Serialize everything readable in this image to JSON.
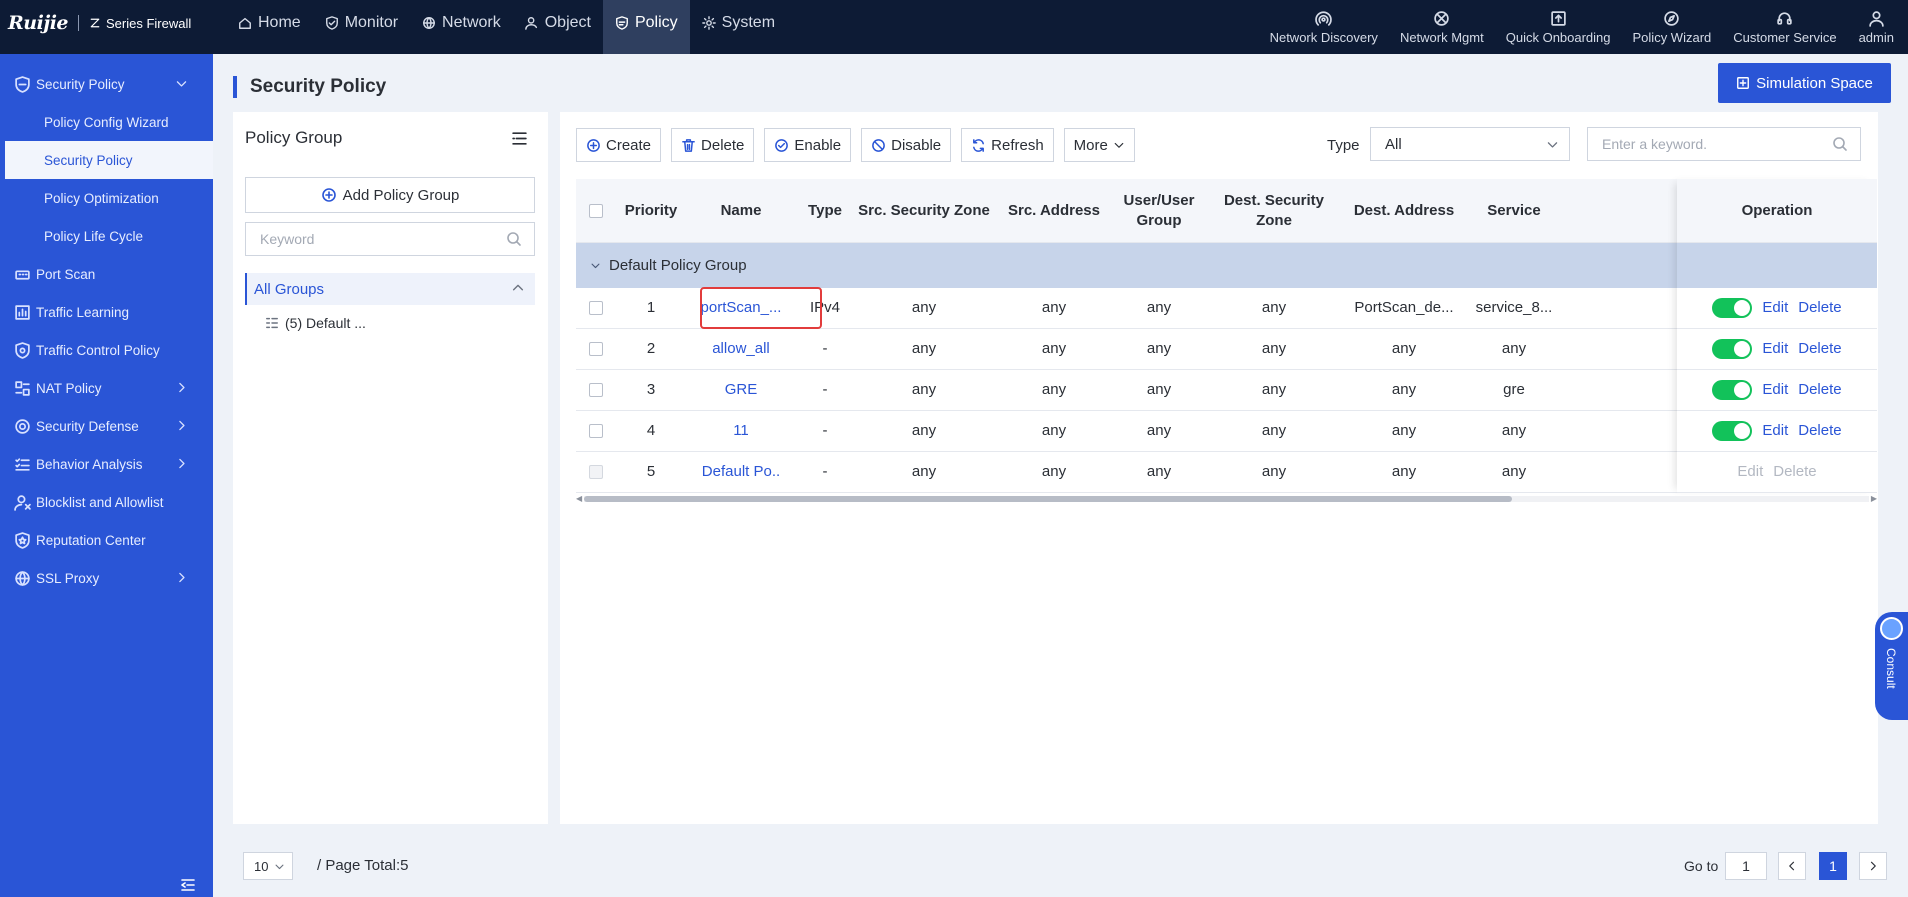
{
  "brand": {
    "logo": "Ruijie",
    "product": "Series Firewall"
  },
  "topnav": [
    {
      "label": "Home",
      "icon": "home-icon"
    },
    {
      "label": "Monitor",
      "icon": "shield-icon"
    },
    {
      "label": "Network",
      "icon": "globe-icon"
    },
    {
      "label": "Object",
      "icon": "user-icon"
    },
    {
      "label": "Policy",
      "icon": "policy-icon",
      "active": true
    },
    {
      "label": "System",
      "icon": "gear-icon"
    }
  ],
  "top_right": {
    "network_discovery": "Network Discovery",
    "network_mgmt": "Network Mgmt",
    "quick_onboarding": "Quick Onboarding",
    "policy_wizard": "Policy Wizard",
    "customer_service": "Customer Service",
    "admin": "admin"
  },
  "sidebar": {
    "security_policy": "Security Policy",
    "sub": {
      "config_wizard": "Policy Config Wizard",
      "security_policy": "Security Policy",
      "optimization": "Policy Optimization",
      "life_cycle": "Policy Life Cycle"
    },
    "port_scan": "Port Scan",
    "traffic_learning": "Traffic Learning",
    "traffic_control": "Traffic Control Policy",
    "nat": "NAT Policy",
    "security_defense": "Security Defense",
    "behavior": "Behavior Analysis",
    "blocklist": "Blocklist and Allowlist",
    "reputation": "Reputation Center",
    "ssl": "SSL Proxy"
  },
  "page": {
    "title": "Security Policy",
    "simulation": "Simulation Space"
  },
  "group_panel": {
    "title": "Policy Group",
    "add": "Add Policy Group",
    "search_placeholder": "Keyword",
    "all_groups": "All Groups",
    "node": "(5) Default ..."
  },
  "toolbar": {
    "create": "Create",
    "delete": "Delete",
    "enable": "Enable",
    "disable": "Disable",
    "refresh": "Refresh",
    "more": "More",
    "type_label": "Type",
    "type_value": "All",
    "keyword_placeholder": "Enter a keyword."
  },
  "table": {
    "headers": {
      "priority": "Priority",
      "name": "Name",
      "type": "Type",
      "src_zone": "Src. Security Zone",
      "src_addr": "Src. Address",
      "user_group": "User/User Group",
      "dest_zone": "Dest. Security Zone",
      "dest_addr": "Dest. Address",
      "service": "Service",
      "operation": "Operation"
    },
    "group_name": "Default Policy Group",
    "edit": "Edit",
    "delete": "Delete",
    "rows": [
      {
        "priority": "1",
        "name": "portScan_...",
        "type": "IPv4",
        "src_zone": "any",
        "src_addr": "any",
        "user": "any",
        "dest_zone": "any",
        "dest_addr": "PortScan_de...",
        "service": "service_8...",
        "enabled": true
      },
      {
        "priority": "2",
        "name": "allow_all",
        "type": "-",
        "src_zone": "any",
        "src_addr": "any",
        "user": "any",
        "dest_zone": "any",
        "dest_addr": "any",
        "service": "any",
        "enabled": true
      },
      {
        "priority": "3",
        "name": "GRE",
        "type": "-",
        "src_zone": "any",
        "src_addr": "any",
        "user": "any",
        "dest_zone": "any",
        "dest_addr": "any",
        "service": "gre",
        "enabled": true
      },
      {
        "priority": "4",
        "name": "11",
        "type": "-",
        "src_zone": "any",
        "src_addr": "any",
        "user": "any",
        "dest_zone": "any",
        "dest_addr": "any",
        "service": "any",
        "enabled": true
      },
      {
        "priority": "5",
        "name": "Default Po..",
        "type": "-",
        "src_zone": "any",
        "src_addr": "any",
        "user": "any",
        "dest_zone": "any",
        "dest_addr": "any",
        "service": "any",
        "enabled": false
      }
    ]
  },
  "footer": {
    "page_size": "10",
    "total": "/ Page Total:5",
    "goto": "Go to",
    "goto_value": "1",
    "current_page": "1"
  },
  "consult": "Consult",
  "colors": {
    "accent": "#2a55d6",
    "topbar": "#0d1b35",
    "toggle_on": "#12c25a",
    "highlight": "#e23c3c"
  }
}
